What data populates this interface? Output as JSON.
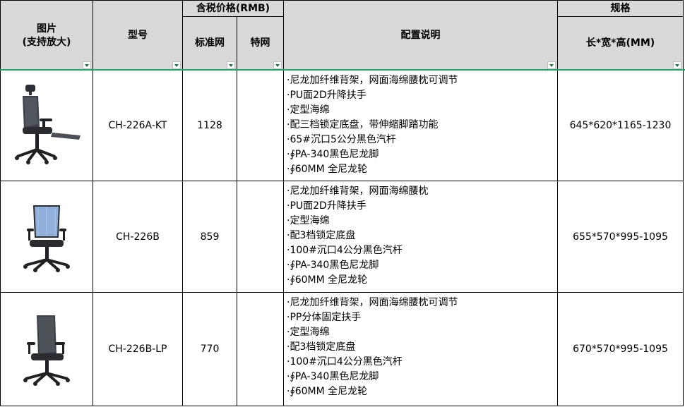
{
  "header": {
    "image_col": "图片\n(支持放大)",
    "model_col": "型号",
    "price_group": "含税价格(RMB)",
    "price_standard": "标准网",
    "price_special": "特网",
    "config_col": "配置说明",
    "spec_group": "规格",
    "spec_dims": "长*宽*高(MM)"
  },
  "rows": [
    {
      "model": "CH-226A-KT",
      "price_standard": "1128",
      "price_special": "",
      "config": [
        "·尼龙加纤维背架，网面海绵腰枕可调节",
        "·PU面2D升降扶手",
        "·定型海绵",
        "·配三档锁定底盘，带伸缩脚踏功能",
        "·65#沉口5公分黑色汽杆",
        "·∮PA-340黑色尼龙脚",
        "·∮60MM 全尼龙轮"
      ],
      "dims": "645*620*1165-1230",
      "image": "black-mesh-chair-with-headrest-and-footrest"
    },
    {
      "model": "CH-226B",
      "price_standard": "859",
      "price_special": "",
      "config": [
        "·尼龙加纤维背架，网面海绵腰枕",
        "·PU面2D升降扶手",
        "·定型海绵",
        "·配3档锁定底盘",
        "·100#沉口4公分黑色汽杆",
        "·∮PA-340黑色尼龙脚",
        "·∮60MM 全尼龙轮"
      ],
      "dims": "655*570*995-1095",
      "image": "blue-mesh-chair"
    },
    {
      "model": "CH-226B-LP",
      "price_standard": "770",
      "price_special": "",
      "config": [
        "·尼龙加纤维背架，网面海绵腰枕可调节",
        "·PP分体固定扶手",
        "·定型海绵",
        "·配3档锁定底盘",
        "·100#沉口4公分黑色汽杆",
        "·∮PA-340黑色尼龙脚",
        "·∮60MM 全尼龙轮"
      ],
      "dims": "670*570*995-1095",
      "image": "black-mesh-chair"
    }
  ],
  "colors": {
    "header_bg": "#d9d9d9",
    "filter_green": "#21a366",
    "chair_blue": "#8fb0d9"
  }
}
